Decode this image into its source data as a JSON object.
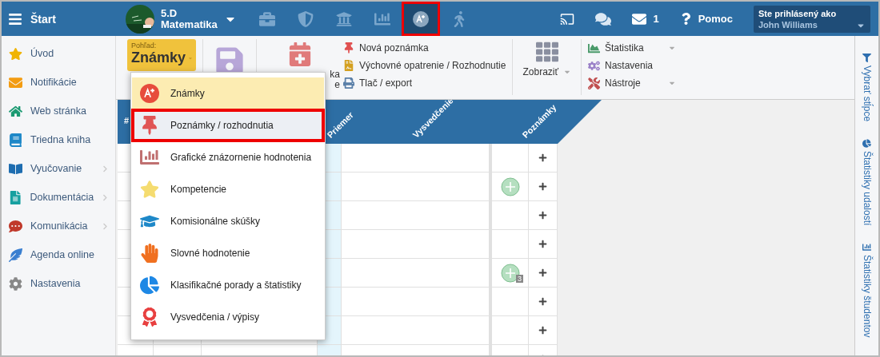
{
  "top_bar": {
    "start_label": "Štart",
    "class_name": "5.D",
    "subject": "Matematika",
    "module_icons": [
      {
        "kind": "briefcase",
        "selected": false,
        "highlighted": false
      },
      {
        "kind": "shield",
        "selected": false,
        "highlighted": false
      },
      {
        "kind": "bank",
        "selected": false,
        "highlighted": false
      },
      {
        "kind": "chart",
        "selected": false,
        "highlighted": false
      },
      {
        "kind": "grade",
        "selected": true,
        "highlighted": true
      },
      {
        "kind": "walk",
        "selected": false,
        "highlighted": false
      }
    ],
    "messages_count": "1",
    "help_label": "Pomoc",
    "user": {
      "caption": "Ste prihlásený ako",
      "name": "John Williams"
    }
  },
  "sidebar": {
    "items": [
      {
        "label": "Úvod",
        "kind": "star",
        "has_submenu": false
      },
      {
        "label": "Notifikácie",
        "kind": "mail",
        "has_submenu": false
      },
      {
        "label": "Web stránka",
        "kind": "home",
        "has_submenu": false
      },
      {
        "label": "Triedna kniha",
        "kind": "book",
        "has_submenu": false
      },
      {
        "label": "Vyučovanie",
        "kind": "open-book",
        "has_submenu": true
      },
      {
        "label": "Dokumentácia",
        "kind": "doc",
        "has_submenu": true
      },
      {
        "label": "Komunikácia",
        "kind": "chat",
        "has_submenu": true
      },
      {
        "label": "Agenda online",
        "kind": "feather",
        "has_submenu": false
      },
      {
        "label": "Nastavenia",
        "kind": "gear",
        "has_submenu": false
      }
    ]
  },
  "ribbon": {
    "view": {
      "caption": "Pohľad:",
      "value": "Známky"
    },
    "calendar_label": [
      "ka",
      "e"
    ],
    "links": [
      {
        "label": "Nová poznámka",
        "kind": "pin"
      },
      {
        "label": "Výchovné opatrenie / Rozhodnutie",
        "kind": "doc"
      },
      {
        "label": "Tlač / export",
        "kind": "print"
      }
    ],
    "display_label": "Zobraziť",
    "tools": [
      {
        "label": "Štatistika",
        "kind": "area",
        "has_menu": true
      },
      {
        "label": "Nastavenia",
        "kind": "gears",
        "has_menu": false
      },
      {
        "label": "Nástroje",
        "kind": "tools",
        "has_menu": true
      }
    ]
  },
  "view_menu": {
    "items": [
      {
        "label": "Známky",
        "kind": "grade",
        "selected": true,
        "highlighted": false
      },
      {
        "label": "Poznámky / rozhodnutia",
        "kind": "pin",
        "selected": false,
        "highlighted": true
      },
      {
        "label": "Grafické znázornenie hodnotenia",
        "kind": "bars",
        "selected": false,
        "highlighted": false
      },
      {
        "label": "Kompetencie",
        "kind": "star",
        "selected": false,
        "highlighted": false
      },
      {
        "label": "Komisionálne skúšky",
        "kind": "exam",
        "selected": false,
        "highlighted": false
      },
      {
        "label": "Slovné hodnotenie",
        "kind": "hand",
        "selected": false,
        "highlighted": false
      },
      {
        "label": "Klasifikačné porady a štatistiky",
        "kind": "report",
        "selected": false,
        "highlighted": false
      },
      {
        "label": "Vysvedčenia / výpisy",
        "kind": "certificate",
        "selected": false,
        "highlighted": false
      }
    ]
  },
  "table": {
    "columns": [
      "#",
      "Priemer",
      "Vysvedčenie",
      "Poznámky"
    ],
    "rows": [
      {
        "note": false
      },
      {
        "note": true
      },
      {
        "note": false
      },
      {
        "note": false
      },
      {
        "note": true,
        "note_count": "3"
      },
      {
        "note": false
      },
      {
        "note": false
      },
      {
        "note": false
      }
    ]
  },
  "right_rail": [
    {
      "label": "Vybrať stĺpce",
      "kind": "filter"
    },
    {
      "label": "Štatistiky udalostí",
      "kind": "pie"
    },
    {
      "label": "Štatistiky študentov",
      "kind": "bars"
    }
  ]
}
